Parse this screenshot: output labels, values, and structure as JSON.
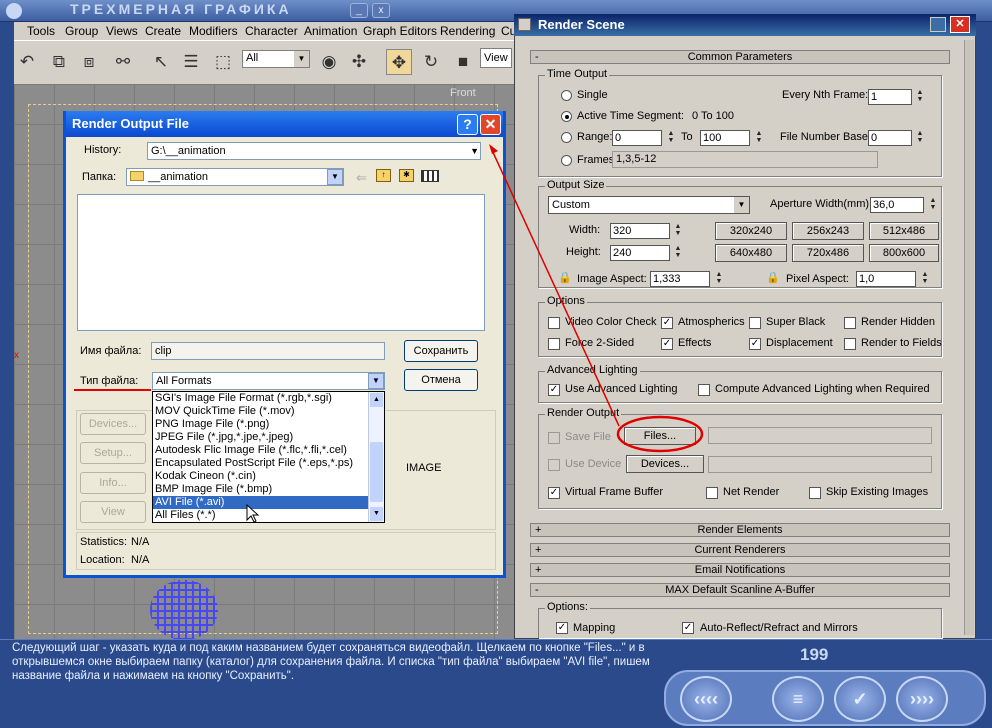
{
  "app": {
    "title": "ТРЕХМЕРНАЯ ГРАФИКА"
  },
  "menu": [
    "Tools",
    "Group",
    "Views",
    "Create",
    "Modifiers",
    "Character",
    "Animation",
    "Graph Editors",
    "Rendering",
    "Cu"
  ],
  "toolbar": {
    "filter": "All",
    "view": "View"
  },
  "viewport": {
    "label": "Front"
  },
  "dialog": {
    "title": "Render Output File",
    "help": "?",
    "close": "✕",
    "history_label": "History:",
    "history_value": "G:\\__animation",
    "folder_label": "Папка:",
    "folder_value": "__animation",
    "filename_label": "Имя файла:",
    "filename_value": "clip",
    "filetype_label": "Тип файла:",
    "filetype_value": "All Formats",
    "save_button": "Сохранить",
    "cancel_button": "Отмена",
    "file_types": [
      "SGI's Image File Format (*.rgb,*.sgi)",
      "MOV QuickTime File (*.mov)",
      "PNG Image File (*.png)",
      "JPEG File (*.jpg,*.jpe,*.jpeg)",
      "Autodesk Flic Image File (*.flc,*.fli,*.cel)",
      "Encapsulated PostScript File (*.eps,*.ps)",
      "Kodak Cineon (*.cin)",
      "BMP Image File (*.bmp)",
      "AVI File (*.avi)",
      "All Files (*.*)"
    ],
    "selected_type": "AVI File (*.avi)",
    "devices_button": "Devices...",
    "setup_button": "Setup...",
    "info_button": "Info...",
    "view_button": "View",
    "image_label": "IMAGE",
    "statistics_label": "Statistics:",
    "statistics_value": "N/A",
    "location_label": "Location:",
    "location_value": "N/A"
  },
  "render_scene": {
    "title": "Render Scene",
    "common_parameters": "Common Parameters",
    "time_output": "Time Output",
    "single": "Single",
    "every_nth": "Every Nth Frame:",
    "every_nth_value": "1",
    "active_segment": "Active Time Segment:",
    "active_segment_value": "0 To 100",
    "range": "Range:",
    "range_from": "0",
    "range_to_label": "To",
    "range_to": "100",
    "file_number_base": "File Number Base:",
    "file_number_base_value": "0",
    "frames": "Frames",
    "frames_value": "1,3,5-12",
    "output_size": "Output Size",
    "size_preset": "Custom",
    "aperture": "Aperture Width(mm):",
    "aperture_value": "36,0",
    "width_label": "Width:",
    "width_value": "320",
    "height_label": "Height:",
    "height_value": "240",
    "presets": [
      "320x240",
      "256x243",
      "512x486",
      "640x480",
      "720x486",
      "800x600"
    ],
    "image_aspect": "Image Aspect:",
    "image_aspect_value": "1,333",
    "pixel_aspect": "Pixel Aspect:",
    "pixel_aspect_value": "1,0",
    "options": "Options",
    "opt_video_color": "Video Color Check",
    "opt_atmospherics": "Atmospherics",
    "opt_super_black": "Super Black",
    "opt_render_hidden": "Render Hidden",
    "opt_force_2sided": "Force 2-Sided",
    "opt_effects": "Effects",
    "opt_displacement": "Displacement",
    "opt_render_fields": "Render to Fields",
    "advanced_lighting": "Advanced Lighting",
    "use_adv_lighting": "Use Advanced Lighting",
    "compute_adv_lighting": "Compute Advanced Lighting when Required",
    "render_output": "Render Output",
    "save_file": "Save File",
    "files_button": "Files...",
    "use_device": "Use Device",
    "devices_button": "Devices...",
    "virtual_frame_buffer": "Virtual Frame Buffer",
    "net_render": "Net Render",
    "skip_existing": "Skip Existing Images",
    "rollouts": [
      {
        "sign": "+",
        "label": "Render Elements"
      },
      {
        "sign": "+",
        "label": "Current Renderers"
      },
      {
        "sign": "+",
        "label": "Email Notifications"
      },
      {
        "sign": "-",
        "label": "MAX Default Scanline A-Buffer"
      }
    ],
    "options2": "Options:",
    "mapping": "Mapping",
    "auto_reflect": "Auto-Reflect/Refract and Mirrors"
  },
  "footer": {
    "text": "Следующий шаг - указать куда и под каким названием будет сохраняться видеофайл. Щелкаем по кнопке \"Files...\"  и в открывшемся окне выбираем папку (каталог) для сохранения файла. И списка \"тип файла\" выбираем \"AVI file\", пишем название файла и нажимаем на кнопку \"Сохранить\".",
    "page": "199",
    "prev": "‹‹‹‹",
    "menu": "≡",
    "check": "✓",
    "next": "››››"
  }
}
